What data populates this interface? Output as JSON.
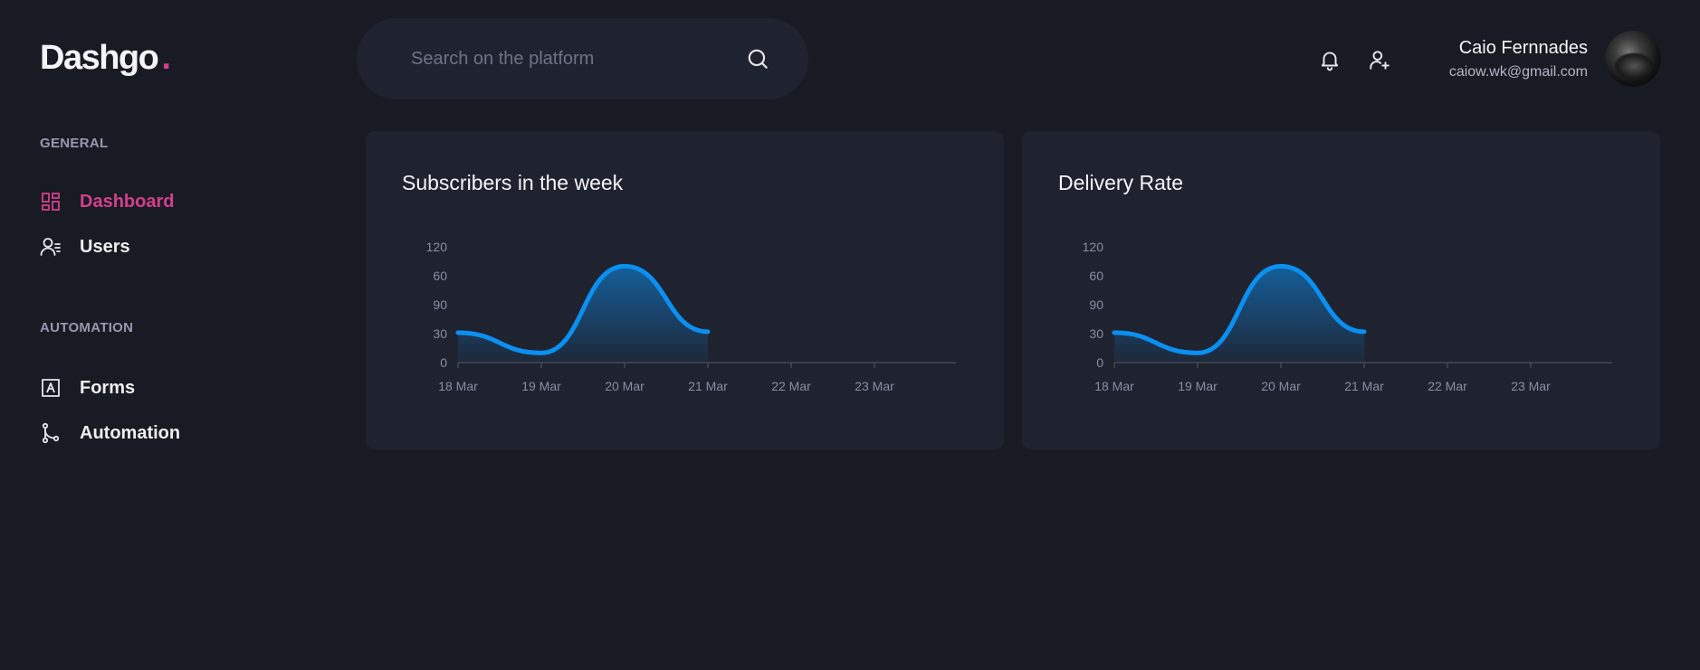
{
  "brand": {
    "name": "Dashgo",
    "dot": "."
  },
  "search": {
    "placeholder": "Search on the platform",
    "icon": "search-icon"
  },
  "header": {
    "icons": [
      "bell-icon",
      "user-plus-icon"
    ],
    "user": {
      "name": "Caio Fernnades",
      "email": "caiow.wk@gmail.com"
    }
  },
  "sidebar": {
    "sections": [
      {
        "title": "GENERAL",
        "items": [
          {
            "label": "Dashboard",
            "icon": "dashboard-icon",
            "active": true
          },
          {
            "label": "Users",
            "icon": "users-icon",
            "active": false
          }
        ]
      },
      {
        "title": "AUTOMATION",
        "items": [
          {
            "label": "Forms",
            "icon": "forms-icon",
            "active": false
          },
          {
            "label": "Automation",
            "icon": "git-branch-icon",
            "active": false
          }
        ]
      }
    ]
  },
  "colors": {
    "accent": "#d53f8c",
    "line": "#0b8ff1",
    "background": "#181b23",
    "card": "#1f2330"
  },
  "cards": [
    {
      "title": "Subscribers in the week"
    },
    {
      "title": "Delivery Rate"
    }
  ],
  "chart_data": [
    {
      "type": "area",
      "title": "Subscribers in the week",
      "x_ticks": [
        "18 Mar",
        "19 Mar",
        "20 Mar",
        "21 Mar",
        "22 Mar",
        "23 Mar"
      ],
      "y_ticks": [
        0,
        30,
        90,
        60,
        120
      ],
      "ylim": [
        0,
        120
      ],
      "grid": false,
      "series": [
        {
          "x": [
            "18 Mar",
            "19 Mar",
            "20 Mar",
            "21 Mar"
          ],
          "values": [
            31,
            10,
            100,
            32
          ]
        }
      ]
    },
    {
      "type": "area",
      "title": "Delivery Rate",
      "x_ticks": [
        "18 Mar",
        "19 Mar",
        "20 Mar",
        "21 Mar",
        "22 Mar",
        "23 Mar"
      ],
      "y_ticks": [
        0,
        30,
        90,
        60,
        120
      ],
      "ylim": [
        0,
        120
      ],
      "grid": false,
      "series": [
        {
          "x": [
            "18 Mar",
            "19 Mar",
            "20 Mar",
            "21 Mar"
          ],
          "values": [
            31,
            10,
            100,
            32
          ]
        }
      ]
    }
  ]
}
